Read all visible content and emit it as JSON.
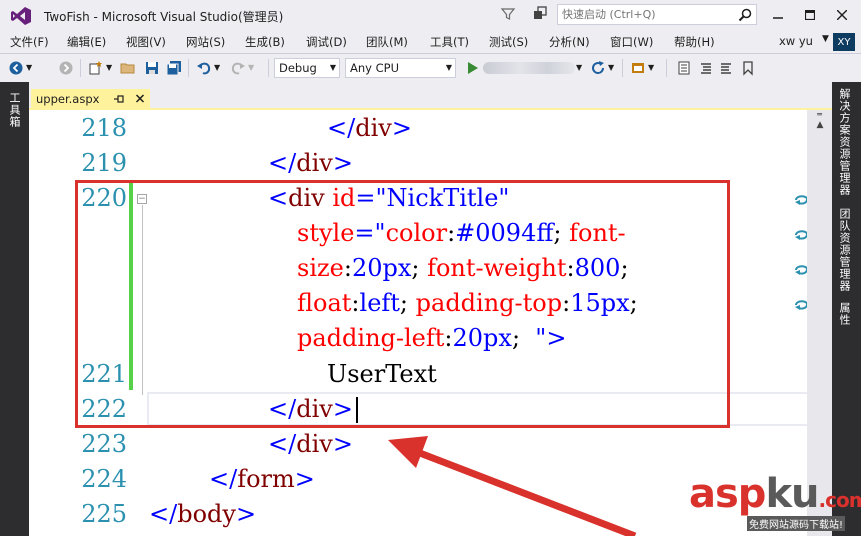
{
  "window": {
    "title": "TwoFish - Microsoft Visual Studio(管理员)",
    "quick_launch_placeholder": "快速启动 (Ctrl+Q)"
  },
  "menu": {
    "items": [
      "文件(F)",
      "编辑(E)",
      "视图(V)",
      "网站(S)",
      "生成(B)",
      "调试(D)",
      "团队(M)",
      "工具(T)",
      "测试(S)",
      "分析(N)",
      "窗口(W)",
      "帮助(H)"
    ],
    "account_name": "xw yu",
    "avatar_initials": "XY"
  },
  "toolbar": {
    "configuration": "Debug",
    "platform": "Any CPU"
  },
  "side_panels": {
    "left": "工具箱",
    "right": [
      "解决方案资源管理器",
      "团队资源管理器",
      "属性"
    ]
  },
  "tab": {
    "file_name": "upper.aspx",
    "pin_glyph": "⊣",
    "close_glyph": "×"
  },
  "editor": {
    "lines": [
      {
        "number": "218",
        "text": "</div>"
      },
      {
        "number": "219",
        "text": "</div>"
      },
      {
        "number": "220",
        "text": "<div id=\"NickTitle\" style=\"color:#0094ff; font-size:20px; font-weight:800; float:left; padding-top:15px; padding-left:20px;  \">"
      },
      {
        "number": "221",
        "text": "UserText"
      },
      {
        "number": "222",
        "text": "</div>"
      },
      {
        "number": "223",
        "text": "</div>"
      },
      {
        "number": "224",
        "text": "</form>"
      },
      {
        "number": "225",
        "text": "</body>"
      }
    ]
  },
  "colors": {
    "line_number": "#2B91AF",
    "tag": "#800000",
    "attribute": "#FF0000",
    "value": "#0000FF",
    "tab_active": "#FFF29D",
    "annotation_red": "#D9312B"
  },
  "watermark": {
    "logo_main": "asp",
    "logo_accent": "ku",
    "logo_suffix": ".com",
    "tagline": "免费网站源码下载站!"
  }
}
